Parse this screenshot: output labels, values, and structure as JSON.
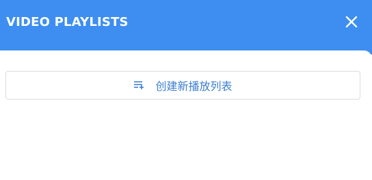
{
  "header": {
    "title": "VIDEO PLAYLISTS",
    "close_icon": "close-icon",
    "background_color": "#3d8ef0"
  },
  "main": {
    "create_button": {
      "label": "创建新播放列表",
      "icon": "playlist-add-icon",
      "text_color": "#3d7fd0"
    }
  }
}
